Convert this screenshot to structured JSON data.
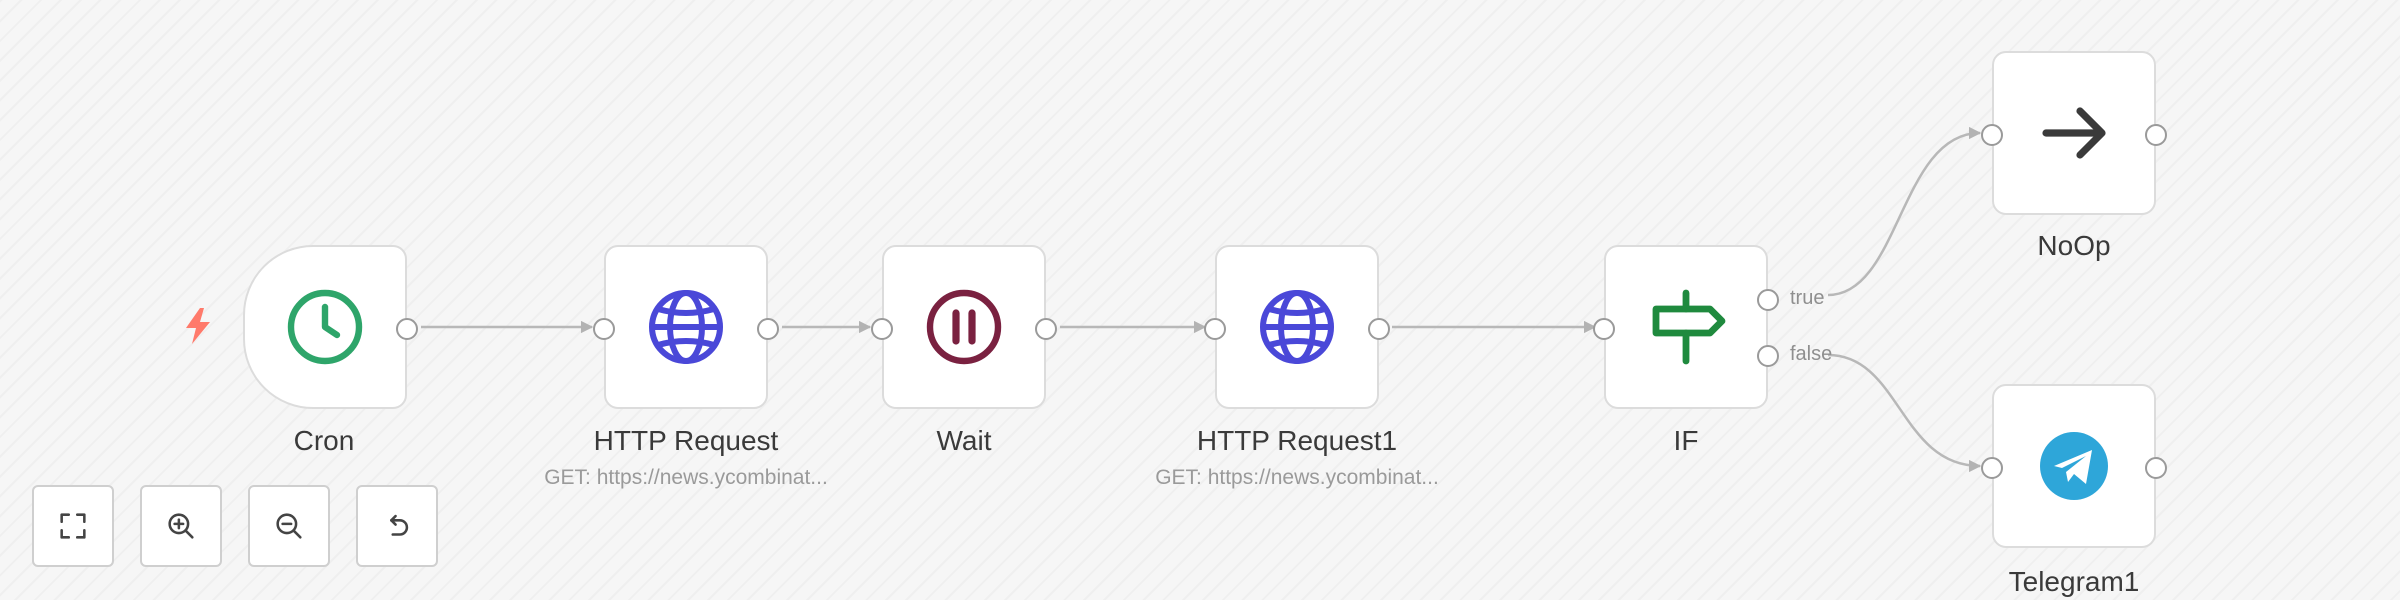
{
  "nodes": {
    "cron": {
      "label": "Cron",
      "icon": "clock-icon"
    },
    "http1": {
      "label": "HTTP Request",
      "subtitle": "GET: https://news.ycombinat...",
      "icon": "globe-icon"
    },
    "wait": {
      "label": "Wait",
      "icon": "pause-icon"
    },
    "http2": {
      "label": "HTTP Request1",
      "subtitle": "GET: https://news.ycombinat...",
      "icon": "globe-icon"
    },
    "if": {
      "label": "IF",
      "icon": "signpost-icon",
      "true_label": "true",
      "false_label": "false"
    },
    "noop": {
      "label": "NoOp",
      "icon": "arrow-right-icon"
    },
    "telegram": {
      "label": "Telegram1",
      "icon": "telegram-icon"
    }
  },
  "controls": [
    "fit-view",
    "zoom-in",
    "zoom-out",
    "reset-zoom"
  ],
  "colors": {
    "clock": "#2ea56a",
    "globe": "#4a48d8",
    "pause": "#7a2140",
    "signpost": "#1f8a3e",
    "telegram": "#2ea6d9",
    "trigger_bolt": "#ff7a6b",
    "edge": "#b3b3b3"
  }
}
